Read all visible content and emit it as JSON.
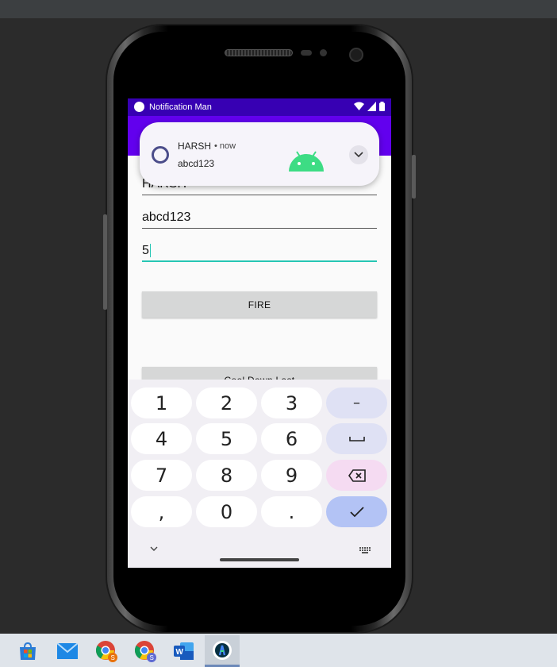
{
  "status_bar": {
    "app_title": "Notification Man"
  },
  "form": {
    "title_value": "HARSH",
    "message_value": "abcd123",
    "count_value": "5",
    "fire_label": "FIRE",
    "cooldown_label": "Cool Down Last"
  },
  "notification": {
    "title": "HARSH",
    "time": "• now",
    "text": "abcd123"
  },
  "keyboard": {
    "rows": [
      [
        "1",
        "2",
        "3",
        "–"
      ],
      [
        "4",
        "5",
        "6",
        "␣"
      ],
      [
        "7",
        "8",
        "9",
        "⌫"
      ],
      [
        ",",
        "0",
        ".",
        "✓"
      ]
    ]
  },
  "taskbar": {
    "items": [
      "microsoft-store-icon",
      "mail-icon",
      "chrome-icon",
      "chrome-icon",
      "word-icon",
      "android-studio-icon"
    ]
  },
  "colors": {
    "status_bar": "#3700b3",
    "app_bar": "#6200ee",
    "focus_underline": "#26c6b4",
    "android_green": "#3ddc84"
  }
}
